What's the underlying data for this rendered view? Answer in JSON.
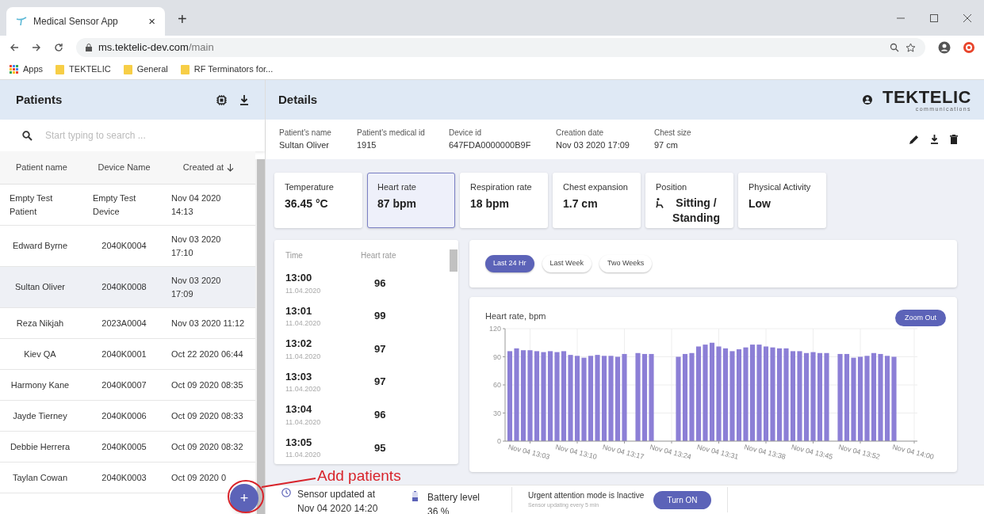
{
  "browser": {
    "tab_title": "Medical Sensor App",
    "tab_close": "×",
    "new_tab": "+",
    "url_host": "ms.tektelic-dev.com",
    "url_path": "/main",
    "bookmarks": [
      "Apps",
      "TEKTELIC",
      "General",
      "RF Terminators for..."
    ]
  },
  "patients": {
    "title": "Patients",
    "search_placeholder": "Start typing to search ...",
    "columns": [
      "Patient name",
      "Device Name",
      "Created at"
    ],
    "rows": [
      {
        "name": "Empty Test Patient",
        "device": "Empty Test Device",
        "created": "Nov 04 2020 14:13",
        "selected": false
      },
      {
        "name": "Edward Byrne",
        "device": "2040K0004",
        "created": "Nov 03 2020 17:10",
        "selected": false
      },
      {
        "name": "Sultan Oliver",
        "device": "2040K0008",
        "created": "Nov 03 2020 17:09",
        "selected": true
      },
      {
        "name": "Reza Nikjah",
        "device": "2023A0004",
        "created": "Nov 03 2020 11:12",
        "selected": false
      },
      {
        "name": "Kiev QA",
        "device": "2040K0001",
        "created": "Oct 22 2020 06:44",
        "selected": false
      },
      {
        "name": "Harmony Kane",
        "device": "2040K0007",
        "created": "Oct 09 2020 08:35",
        "selected": false
      },
      {
        "name": "Jayde Tierney",
        "device": "2040K0006",
        "created": "Oct 09 2020 08:33",
        "selected": false
      },
      {
        "name": "Debbie Herrera",
        "device": "2040K0005",
        "created": "Oct 09 2020 08:32",
        "selected": false
      },
      {
        "name": "Taylan Cowan",
        "device": "2040K0003",
        "created": "Oct 09 2020 0",
        "selected": false
      }
    ],
    "add_button": "+"
  },
  "details": {
    "title": "Details",
    "logo": "TEKTELIC",
    "logo_sub": "communications",
    "info": [
      {
        "label": "Patient's name",
        "value": "Sultan Oliver"
      },
      {
        "label": "Patient's medical id",
        "value": "1915"
      },
      {
        "label": "Device id",
        "value": "647FDA0000000B9F"
      },
      {
        "label": "Creation date",
        "value": "Nov 03 2020 17:09"
      },
      {
        "label": "Chest size",
        "value": "97 cm"
      }
    ],
    "metrics": [
      {
        "label": "Temperature",
        "value": "36.45 °C",
        "selected": false,
        "kind": "plain"
      },
      {
        "label": "Heart rate",
        "value": "87 bpm",
        "selected": true,
        "kind": "plain"
      },
      {
        "label": "Respiration rate",
        "value": "18 bpm",
        "selected": false,
        "kind": "plain"
      },
      {
        "label": "Chest expansion",
        "value": "1.7 cm",
        "selected": false,
        "kind": "plain"
      },
      {
        "label": "Position",
        "value": "Sitting / Standing",
        "selected": false,
        "kind": "icon"
      },
      {
        "label": "Physical Activity",
        "value": "Low",
        "selected": false,
        "kind": "plain"
      }
    ],
    "readings": {
      "columns": [
        "Time",
        "Heart rate"
      ],
      "rows": [
        {
          "time": "13:00",
          "date": "11.04.2020",
          "value": "96"
        },
        {
          "time": "13:01",
          "date": "11.04.2020",
          "value": "99"
        },
        {
          "time": "13:02",
          "date": "11.04.2020",
          "value": "97"
        },
        {
          "time": "13:03",
          "date": "11.04.2020",
          "value": "97"
        },
        {
          "time": "13:04",
          "date": "11.04.2020",
          "value": "96"
        },
        {
          "time": "13:05",
          "date": "11.04.2020",
          "value": "95"
        }
      ]
    },
    "ranges": [
      {
        "label": "Last 24 Hr",
        "selected": true
      },
      {
        "label": "Last Week",
        "selected": false
      },
      {
        "label": "Two Weeks",
        "selected": false
      }
    ],
    "zoom_button": "Zoom Out",
    "chart_data": {
      "type": "bar",
      "title": "Heart rate, bpm",
      "categories": [
        null,
        null,
        null,
        "Nov 04 13:03",
        null,
        null,
        null,
        null,
        null,
        null,
        "Nov 04 13:10",
        null,
        null,
        null,
        null,
        null,
        null,
        "Nov 04 13:17",
        null,
        null,
        null,
        null,
        null,
        null,
        "Nov 04 13:24",
        null,
        null,
        null,
        null,
        null,
        null,
        "Nov 04 13:31",
        null,
        null,
        null,
        null,
        null,
        null,
        "Nov 04 13:38",
        null,
        null,
        null,
        null,
        null,
        null,
        "Nov 04 13:45",
        null,
        null,
        null,
        null,
        null,
        null,
        "Nov 04 13:52",
        null,
        null,
        null,
        null,
        null,
        null,
        null,
        "Nov 04 14:00"
      ],
      "grid": true,
      "series": [
        {
          "color": "#8c7fd6",
          "values": [
            96,
            99,
            97,
            97,
            96,
            95,
            96,
            95,
            96,
            92,
            91,
            89,
            91,
            92,
            91,
            91,
            90,
            93,
            null,
            94,
            93,
            93,
            null,
            null,
            null,
            90,
            93,
            94,
            101,
            103,
            105,
            101,
            99,
            96,
            98,
            100,
            103,
            103,
            101,
            100,
            99,
            99,
            96,
            96,
            94,
            95,
            94,
            94,
            null,
            93,
            93,
            89,
            90,
            91,
            94,
            93,
            91,
            90,
            null,
            null,
            null
          ]
        }
      ],
      "ylim": [
        0,
        120
      ],
      "yticks": [
        0,
        30,
        60,
        90,
        120
      ]
    }
  },
  "status": {
    "sensor_label": "Sensor updated at",
    "sensor_value": "Nov 04 2020 14:20",
    "battery_label": "Battery level",
    "battery_value": "36 %",
    "urgent_text": "Urgent attention mode is Inactive",
    "urgent_sub": "Sensor updating every 5 min",
    "button": "Turn ON"
  },
  "annotation": "Add patients"
}
